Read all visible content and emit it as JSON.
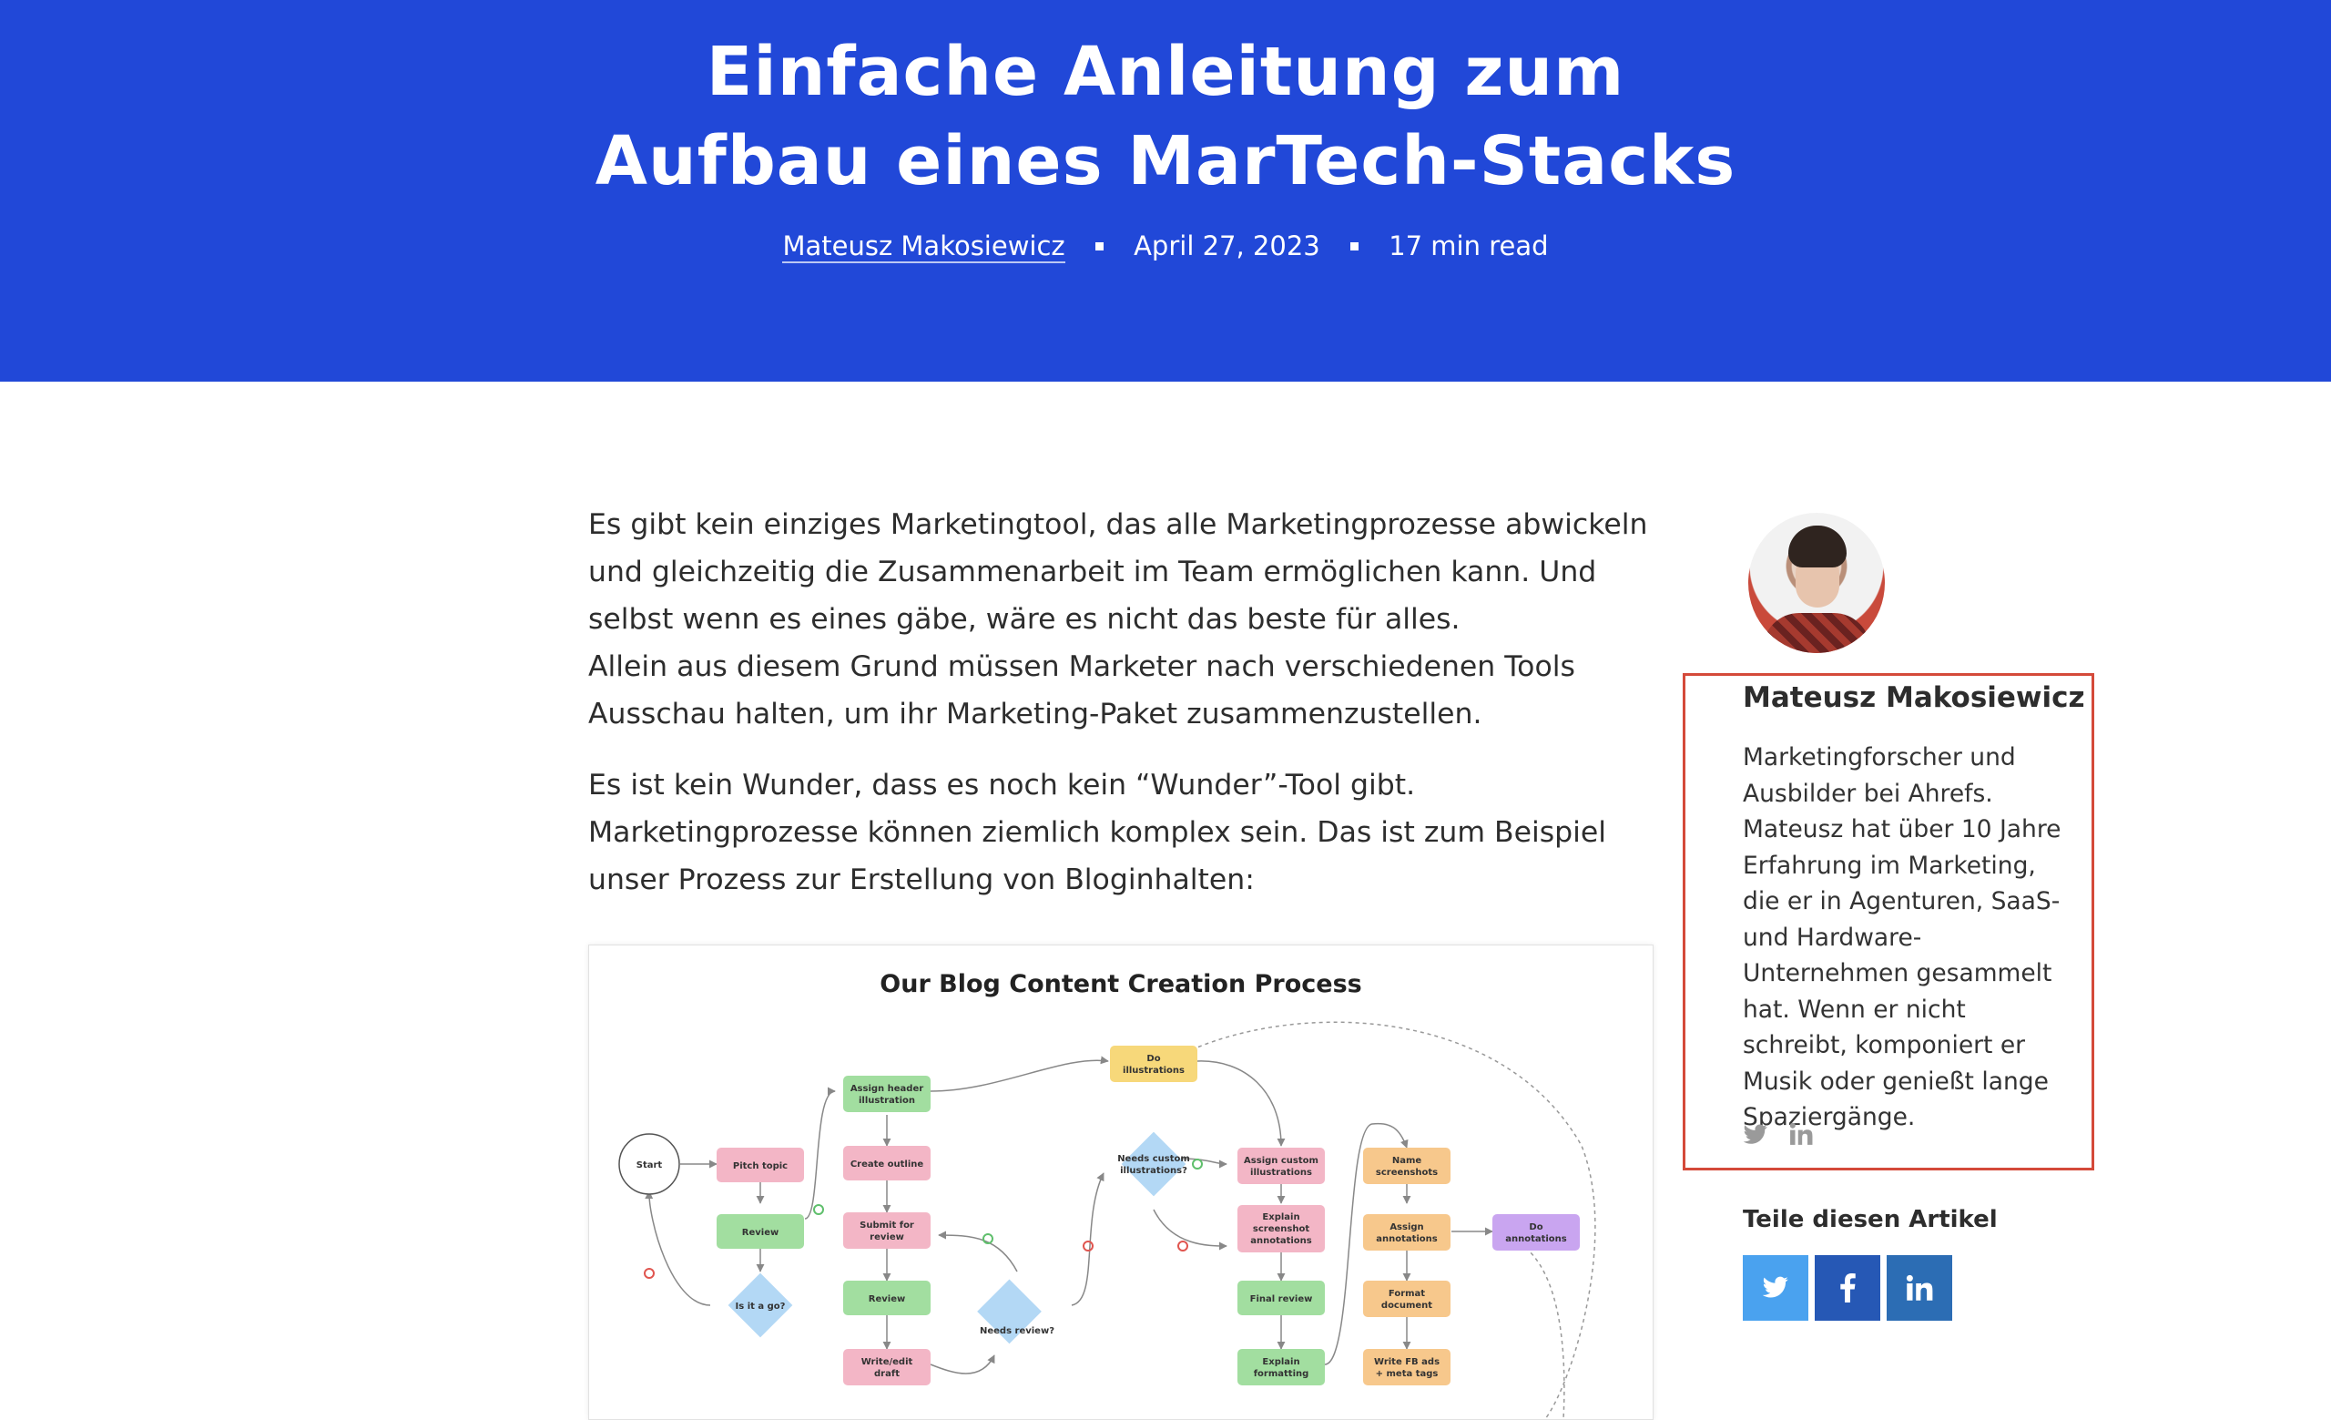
{
  "header": {
    "title_line1": "Einfache Anleitung zum",
    "title_line2": "Aufbau eines MarTech-Stacks",
    "author": "Mateusz Makosiewicz",
    "date": "April 27, 2023",
    "read_time": "17 min read"
  },
  "article": {
    "p1": "Es gibt kein einziges Marketingtool, das alle Marketingprozesse abwickeln und gleichzeitig die Zusammenarbeit im Team ermöglichen kann. Und selbst wenn es eines gäbe, wäre es nicht das beste für alles.",
    "p1b": "Allein aus diesem Grund müssen Marketer nach verschiedenen Tools Ausschau halten, um ihr Marketing-Paket zusammenzustellen.",
    "p2": "Es ist kein Wunder, dass es noch kein “Wunder”-Tool gibt. Marketingprozesse können ziemlich komplex sein. Das ist zum Beispiel unser Prozess zur Erstellung von Bloginhalten:"
  },
  "figure": {
    "title": "Our Blog Content Creation Process",
    "nodes": {
      "start": "Start",
      "pitch": "Pitch topic",
      "review1": "Review",
      "isgo": "Is it a go?",
      "assign_header": [
        "Assign header",
        "illustration"
      ],
      "outline": "Create outline",
      "submit": [
        "Submit for",
        "review"
      ],
      "review2": "Review",
      "write": [
        "Write/edit",
        "draft"
      ],
      "needs_review": "Needs review?",
      "do_ill": [
        "Do",
        "illustrations"
      ],
      "needs_custom": [
        "Needs custom",
        "illustrations?"
      ],
      "assign_custom": [
        "Assign custom",
        "illustrations"
      ],
      "explain_ss": [
        "Explain",
        "screenshot",
        "annotations"
      ],
      "final": "Final review",
      "explain_fmt": [
        "Explain",
        "formatting"
      ],
      "name_ss": [
        "Name",
        "screenshots"
      ],
      "assign_ann": [
        "Assign",
        "annotations"
      ],
      "format_doc": [
        "Format",
        "document"
      ],
      "write_fb": [
        "Write FB ads",
        "+ meta tags"
      ],
      "do_ann": [
        "Do",
        "annotations"
      ]
    }
  },
  "sidebar": {
    "author_name": "Mateusz Makosiewicz",
    "bio": "Marketingforscher und Ausbilder bei Ahrefs. Mateusz hat über 10 Jahre Erfahrung im Marketing, die er in Agenturen, SaaS- und Hardware-Unternehmen gesammelt hat. Wenn er nicht schreibt, komponiert er Musik oder genießt lange Spaziergänge.",
    "share_label": "Teile diesen Artikel"
  },
  "icons": {
    "twitter": "twitter-icon",
    "linkedin": "linkedin-icon",
    "facebook": "facebook-icon"
  },
  "colors": {
    "hero_bg": "#2148d8",
    "highlight_border": "#d44a3a",
    "twitter": "#4aa2ef",
    "facebook": "#2658b5",
    "linkedin": "#2c6db4"
  }
}
